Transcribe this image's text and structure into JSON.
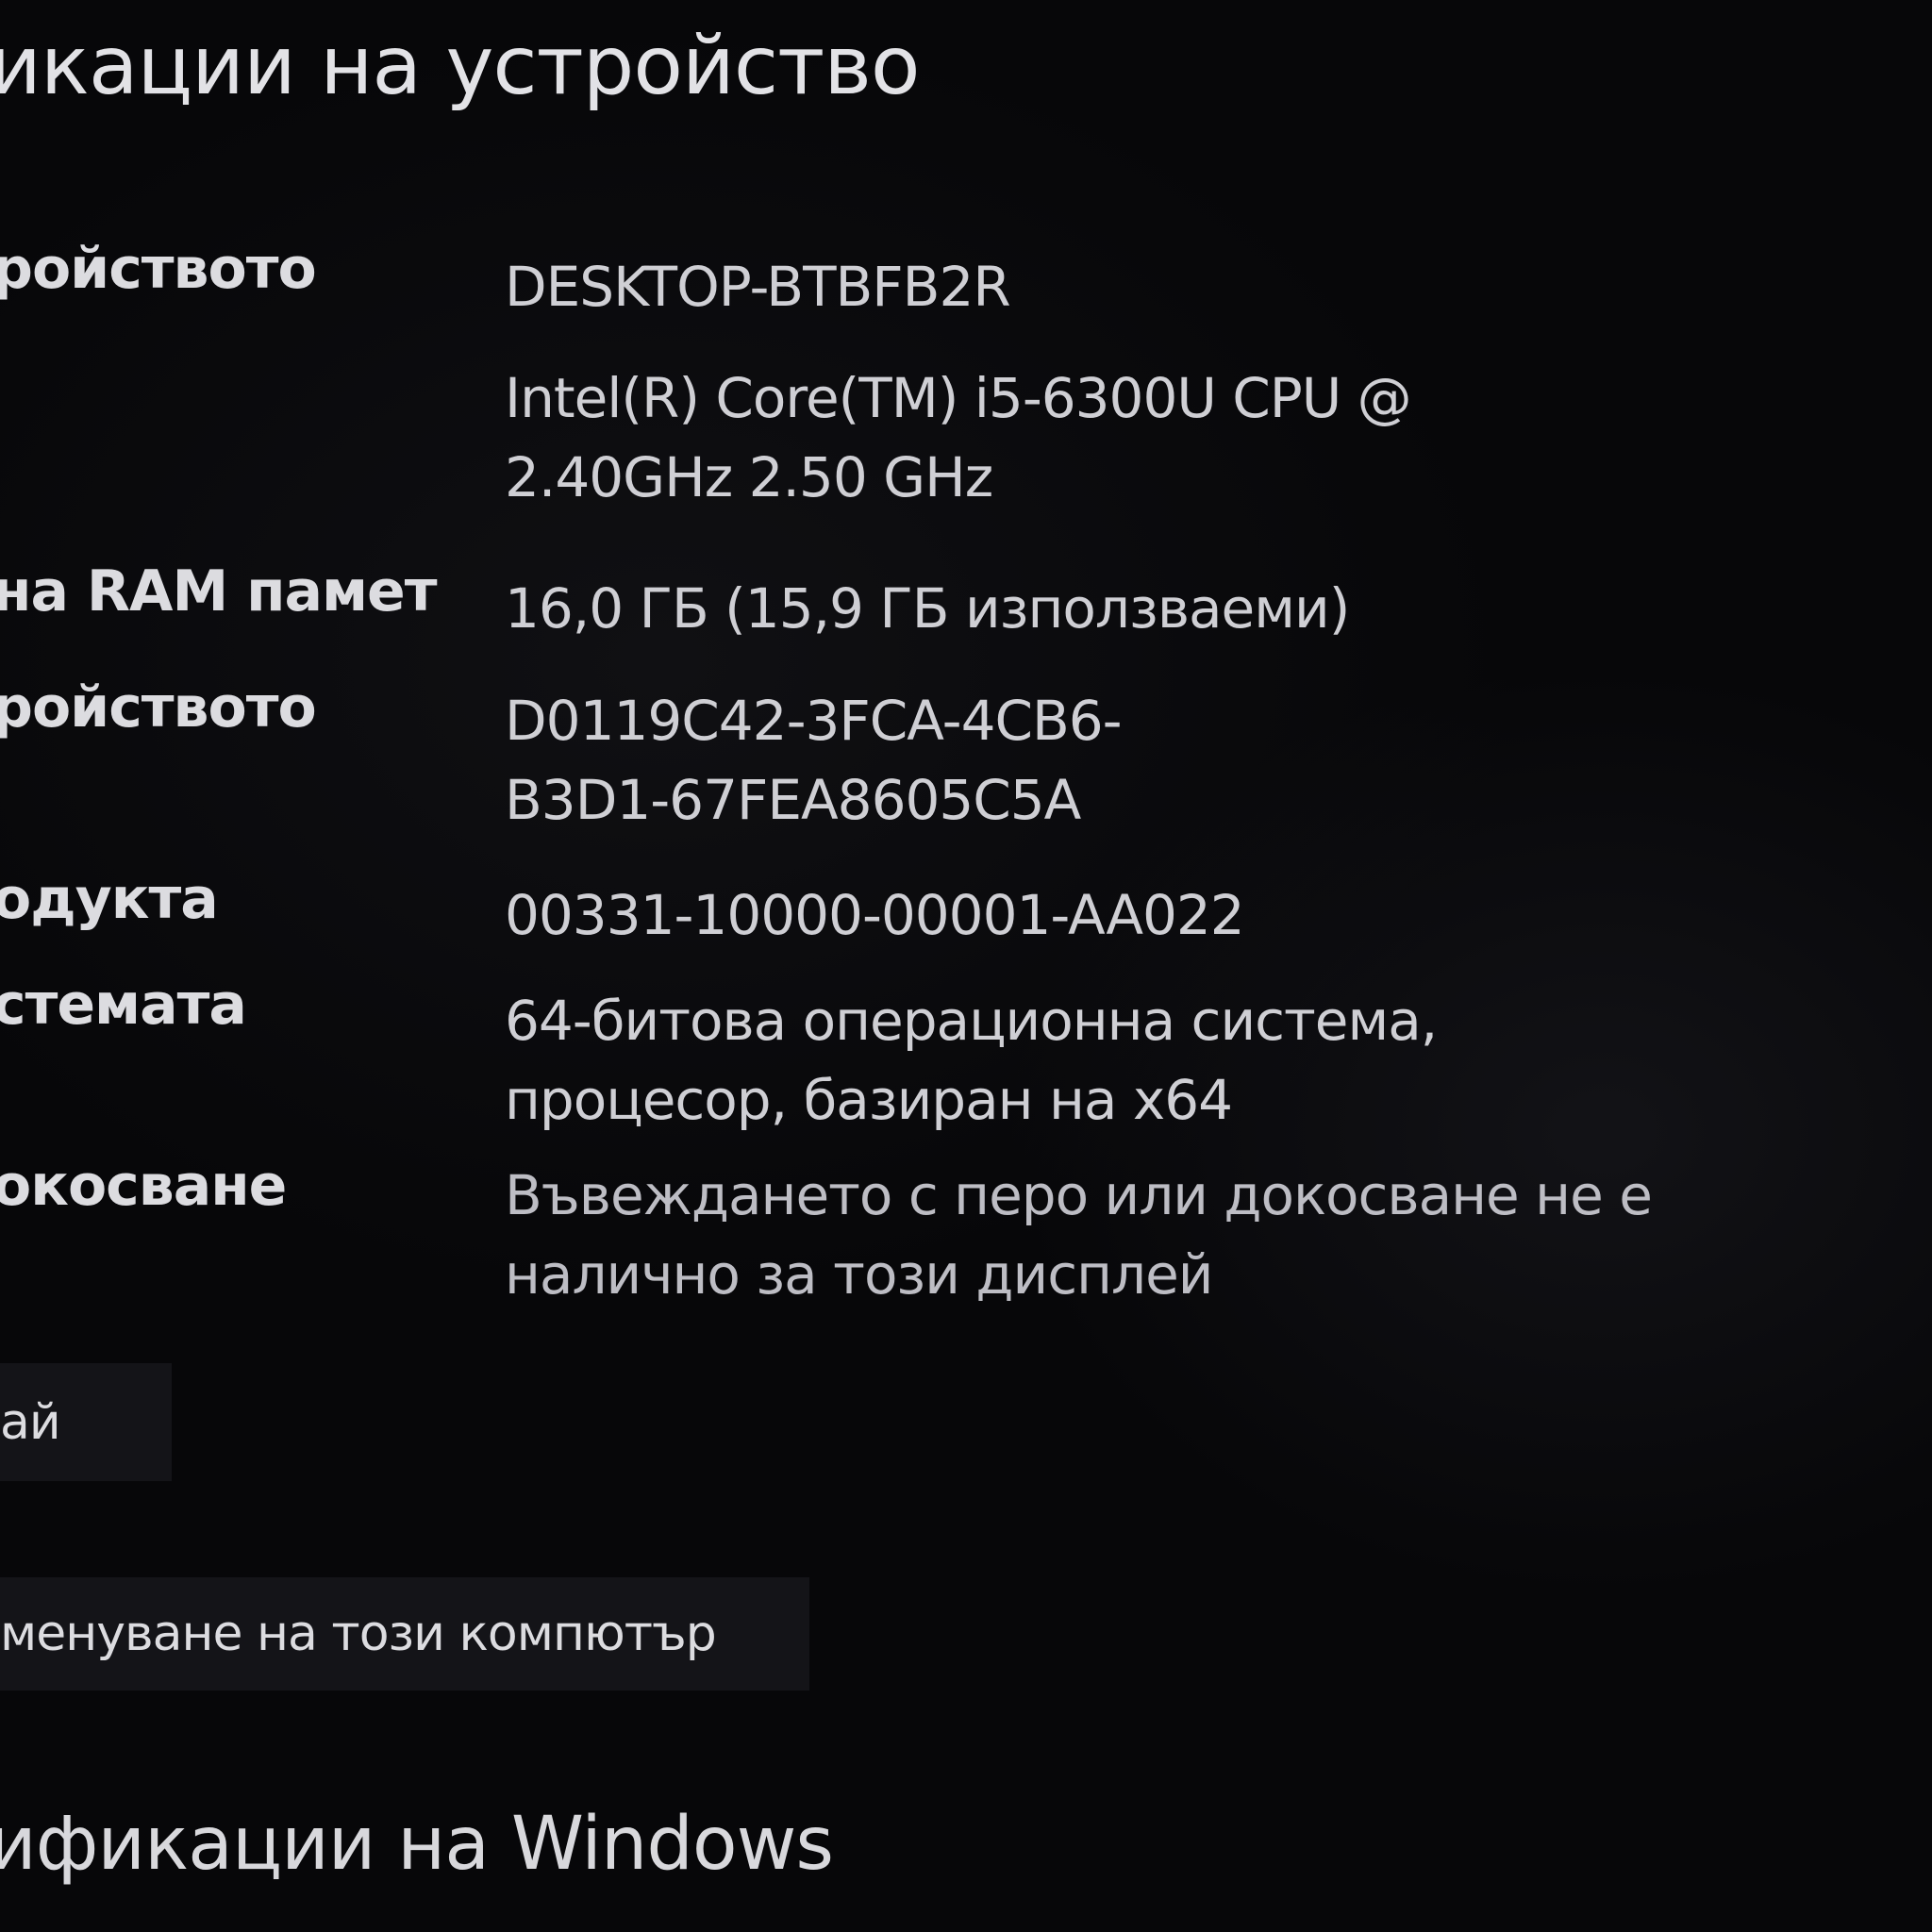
{
  "section_device": {
    "title": "икации на устройство"
  },
  "specs": [
    {
      "label": "ройството",
      "value": "DESKTOP-BTBFB2R"
    },
    {
      "label": "",
      "value": "Intel(R) Core(TM) i5-6300U CPU @\n2.40GHz   2.50 GHz"
    },
    {
      "label": "на RAM памет",
      "value": "16,0 ГБ (15,9 ГБ използваеми)"
    },
    {
      "label": "ройството",
      "value": "D0119C42-3FCA-4CB6-\nB3D1-67FEA8605C5A"
    },
    {
      "label": "одукта",
      "value": "00331-10000-00001-AA022"
    },
    {
      "label": "стемата",
      "value": "64-битова операционна система,\nпроцесор, базиран на x64"
    },
    {
      "label": "окосване",
      "value": "Въвеждането с перо или докосване не е\nналично за този дисплей"
    }
  ],
  "buttons": {
    "copy_label": "ай",
    "rename_label": "менуване на този компютър"
  },
  "section_windows": {
    "title": "ификации на Windows"
  }
}
